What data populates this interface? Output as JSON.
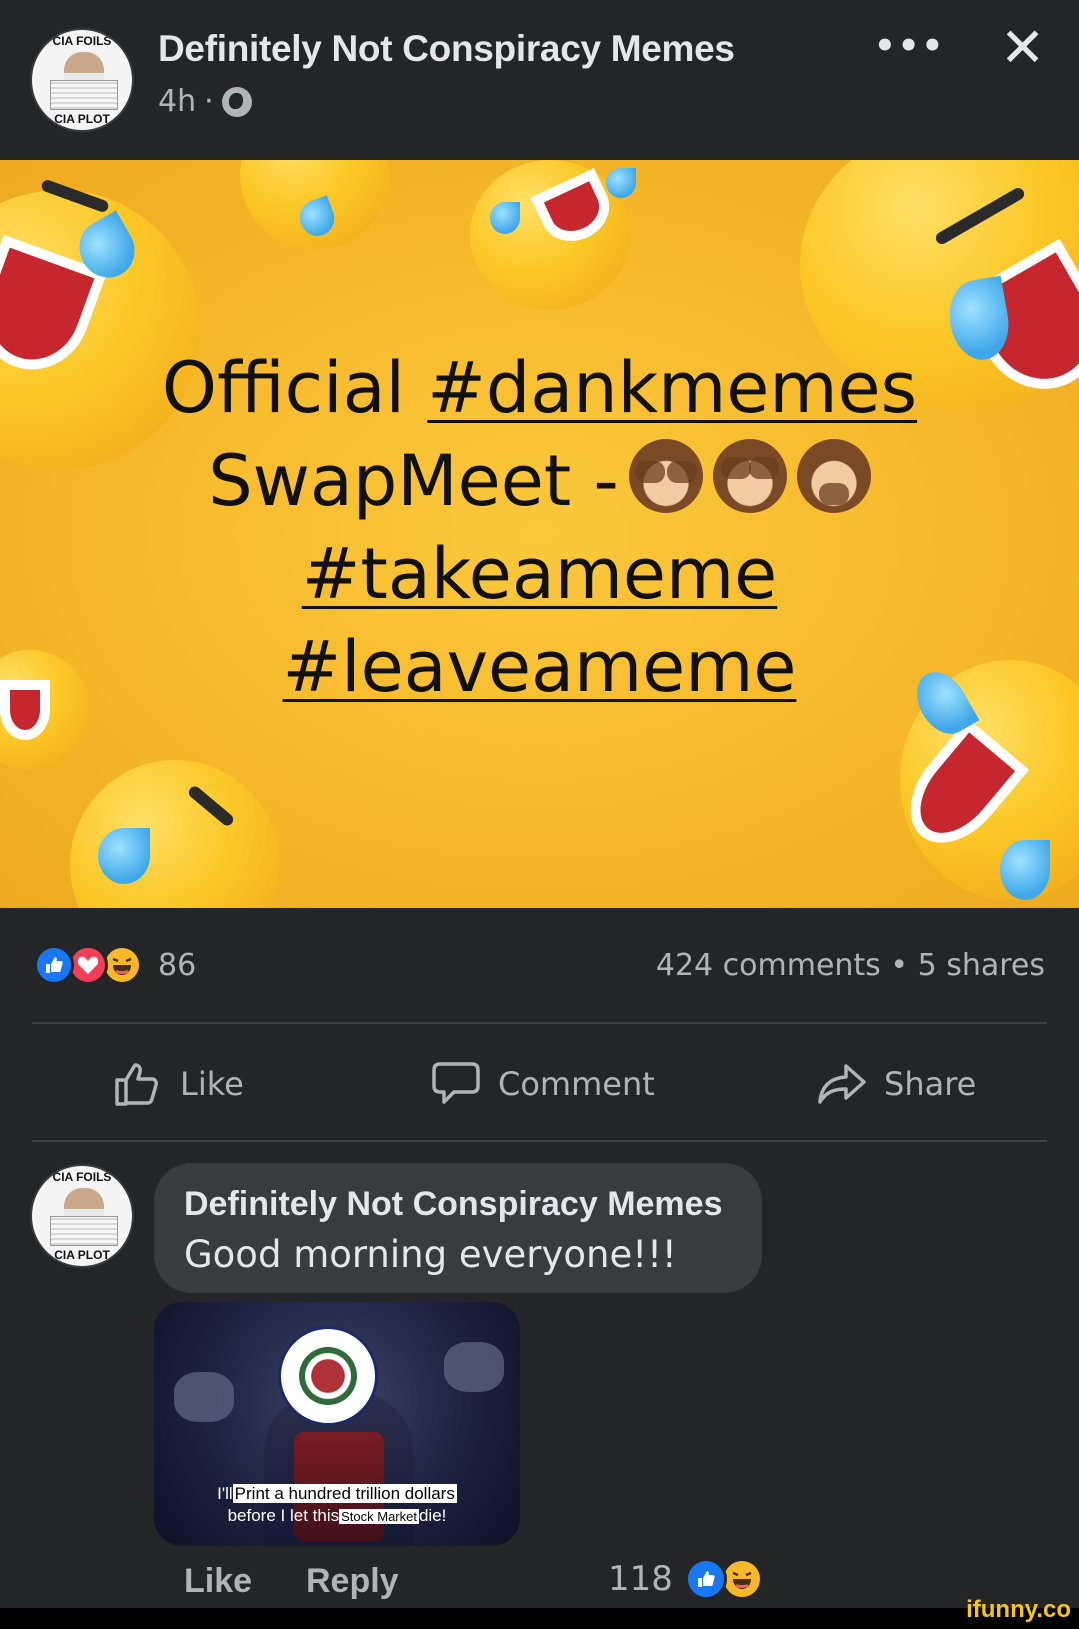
{
  "post": {
    "author": "Definitely Not Conspiracy Memes",
    "timestamp": "4h",
    "separator": "·",
    "privacy_icon": "globe-icon",
    "avatar_text_top": "CIA FOILS",
    "avatar_text_bottom": "CIA PLOT",
    "more_icon": "•••",
    "close_icon": "✕"
  },
  "image": {
    "line1_prefix": "Official ",
    "line1_tag": "#dankmemes",
    "line2_text": "SwapMeet -",
    "line3_tag": "#takeameme",
    "line4_tag": "#leaveameme",
    "monkeys": [
      "see-no-evil-monkey",
      "see-no-evil-monkey",
      "speak-no-evil-monkey"
    ]
  },
  "stats": {
    "reaction_types": [
      "like",
      "love",
      "haha"
    ],
    "reaction_count": "86",
    "comments_shares": "424 comments • 5 shares"
  },
  "actions": {
    "like": "Like",
    "comment": "Comment",
    "share": "Share"
  },
  "comment": {
    "author": "Definitely Not Conspiracy Memes",
    "text": "Good morning everyone!!!",
    "avatar_text_top": "CIA FOILS",
    "avatar_text_bottom": "CIA PLOT",
    "image_caption_line1_prefix": "I'll",
    "image_caption_line1_highlight": "Print a hundred trillion dollars",
    "image_caption_line2_prefix": "before I let this",
    "image_caption_line2_highlight": "Stock Market",
    "image_caption_line2_suffix": "die!",
    "like_label": "Like",
    "reply_label": "Reply",
    "reaction_count": "118",
    "reaction_types": [
      "like",
      "haha"
    ]
  },
  "watermark": "ifunny.co",
  "colors": {
    "background": "#242526",
    "bubble": "#3a3b3c",
    "text_primary": "#e4e6eb",
    "text_secondary": "#b0b3b8",
    "like_blue": "#1877f2",
    "love_red": "#f33e58",
    "haha_yellow": "#f7b928",
    "image_yellow": "#f6b72a"
  }
}
